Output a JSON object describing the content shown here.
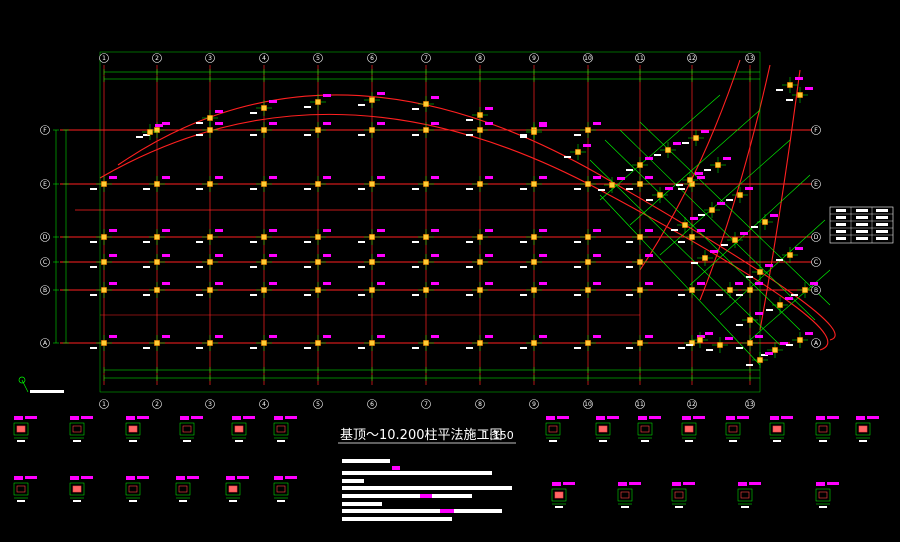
{
  "drawing": {
    "title": "基顶～10.200柱平法施工图",
    "scale": "1:150"
  },
  "colors": {
    "background": "#000000",
    "axis_line": "#ff2020",
    "dimension": "#00ff00",
    "column_fill": "#ffcc33",
    "annotation": "#ff00ff",
    "text": "#ffffff",
    "bubble": "#ffffff"
  },
  "axes": {
    "columns": [
      "1",
      "2",
      "3",
      "4",
      "5",
      "6",
      "7",
      "8",
      "9",
      "10",
      "11",
      "12",
      "13"
    ],
    "rows": [
      "F",
      "E",
      "D",
      "C",
      "B",
      "A"
    ]
  },
  "legend_icon": "north-arrow-icon"
}
